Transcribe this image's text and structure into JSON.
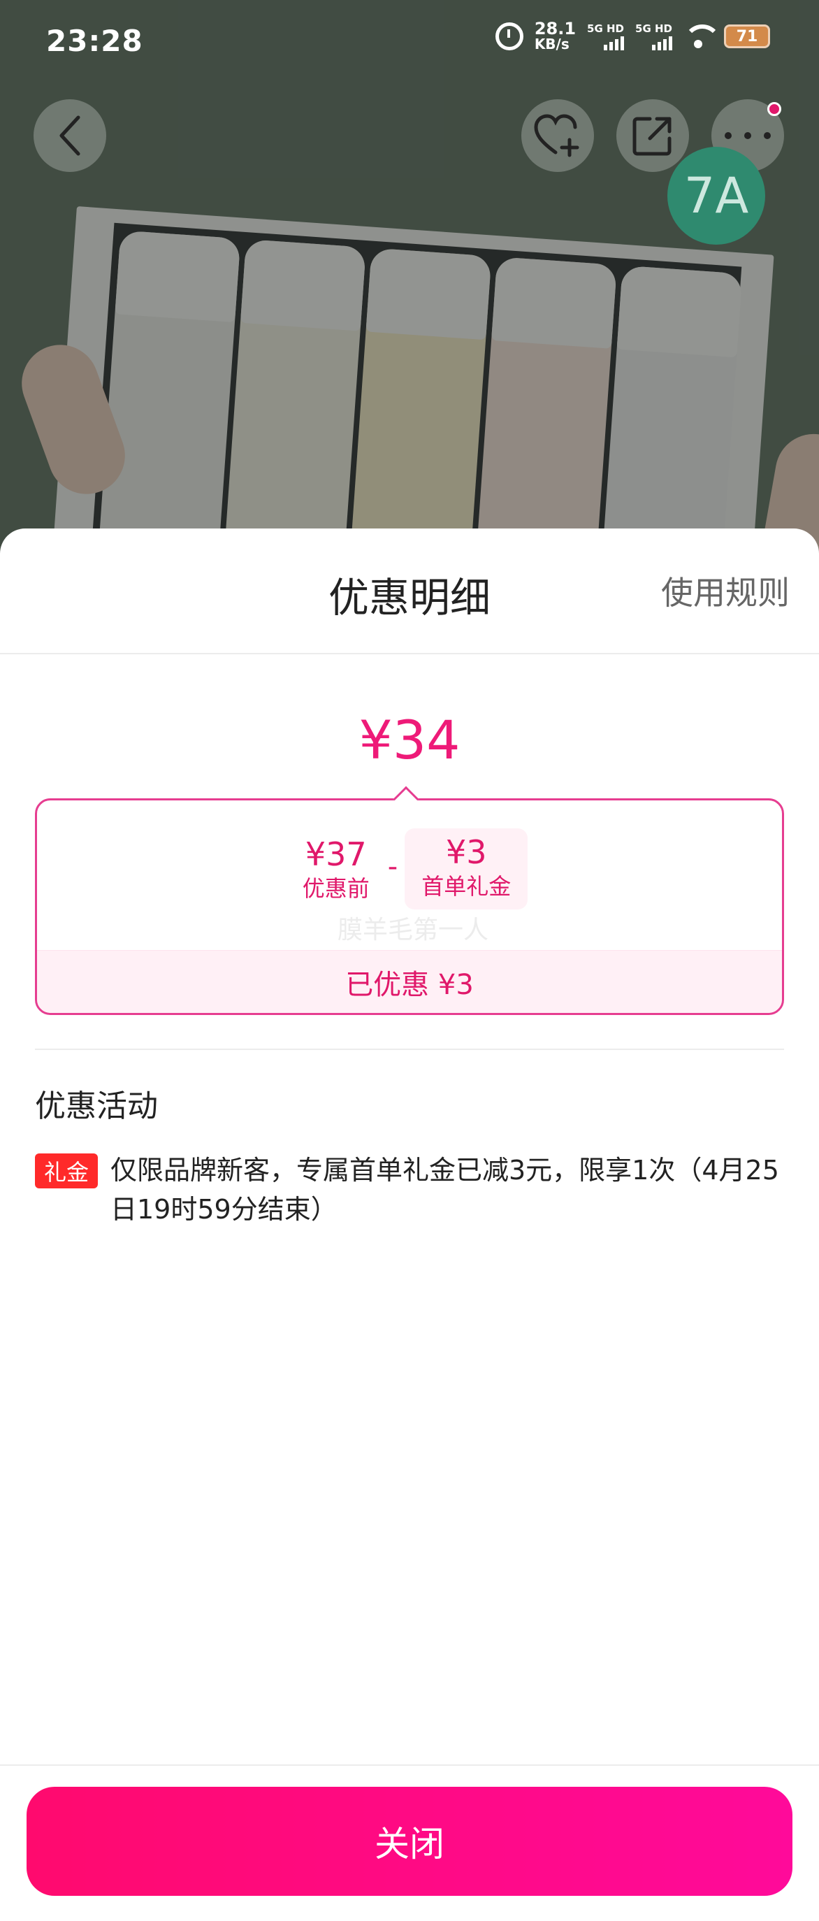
{
  "status_bar": {
    "time": "23:28",
    "net_speed_value": "28.1",
    "net_speed_unit": "KB/s",
    "sim1": "5G HD",
    "sim2": "5G HD",
    "battery": "71"
  },
  "product_header": {
    "back_icon": "chevron-left-icon",
    "favorite_icon": "heart-plus-icon",
    "share_icon": "share-icon",
    "more_icon": "more-icon",
    "badge": "7A"
  },
  "sheet": {
    "title": "优惠明细",
    "rules_link": "使用规则",
    "final_price": "¥34",
    "breakdown": {
      "original_amount": "¥37",
      "original_label": "优惠前",
      "operator": "-",
      "discount_amount": "¥3",
      "discount_label": "首单礼金",
      "faded_text": "膜羊毛第一人",
      "saved_text": "已优惠 ¥3"
    },
    "promotions_title": "优惠活动",
    "promotions": [
      {
        "tag": "礼金",
        "text": "仅限品牌新客，专属首单礼金已减3元，限享1次（4月25日19时59分结束）"
      }
    ],
    "close_button": "关闭"
  },
  "colors": {
    "accent": "#e0186a",
    "button_start": "#ff0a6e",
    "button_end": "#ff0a9a",
    "tag_red": "#ff2a2a"
  }
}
